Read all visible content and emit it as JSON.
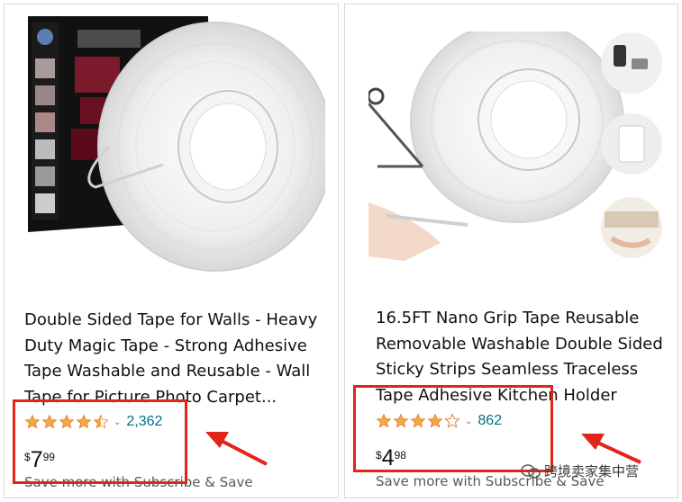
{
  "products": [
    {
      "title": "Double Sided Tape for Walls - Heavy Duty Magic Tape - Strong Adhesive Tape Washable and Reusable - Wall Tape for Picture Photo Carpet...",
      "rating": 4.5,
      "review_count": "2,362",
      "price": {
        "symbol": "$",
        "whole": "7",
        "fraction": "99"
      },
      "subscribe_text": "Save more with Subscribe & Save"
    },
    {
      "title": "16.5FT Nano Grip Tape Reusable Removable Washable Double Sided Sticky Strips Seamless Traceless Tape Adhesive Kitchen Holder",
      "rating": 4.0,
      "review_count": "862",
      "price": {
        "symbol": "$",
        "whole": "4",
        "fraction": "98"
      },
      "subscribe_text": "Save more with Subscribe & Save"
    }
  ],
  "colors": {
    "star": "#f3a847",
    "star_empty": "#ffffff",
    "link": "#007185",
    "highlight": "#e1251b"
  },
  "icons": {
    "chevron": "chevron-down-icon",
    "star": "star-icon",
    "arrow": "red-arrow-icon"
  },
  "watermark": {
    "text": "跨境卖家集中营"
  }
}
